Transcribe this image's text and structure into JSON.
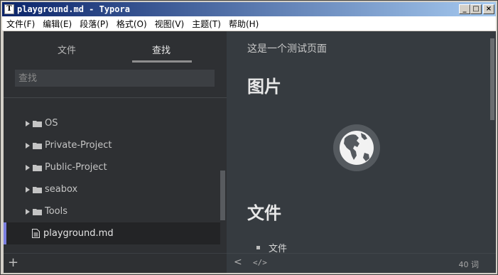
{
  "window": {
    "title": "playground.md - Typora",
    "app_icon": "T",
    "buttons": {
      "minimize": "_",
      "maximize": "□",
      "close": "×"
    }
  },
  "menubar": {
    "items": [
      "文件(F)",
      "编辑(E)",
      "段落(P)",
      "格式(O)",
      "视图(V)",
      "主题(T)",
      "帮助(H)"
    ]
  },
  "sidebar": {
    "tabs": {
      "files": "文件",
      "search": "查找",
      "active": "search"
    },
    "search_placeholder": "查找",
    "tree": [
      {
        "label": "OS",
        "type": "folder"
      },
      {
        "label": "Private-Project",
        "type": "folder"
      },
      {
        "label": "Public-Project",
        "type": "folder"
      },
      {
        "label": "seabox",
        "type": "folder"
      },
      {
        "label": "Tools",
        "type": "folder"
      },
      {
        "label": "playground.md",
        "type": "file",
        "active": true
      }
    ],
    "add_label": "+"
  },
  "editor": {
    "intro": "这是一个测试页面",
    "heading_image": "图片",
    "heading_files": "文件",
    "list_item": "文件",
    "footer": {
      "back": "<",
      "source": "</>",
      "word_count": "40 词"
    }
  },
  "colors": {
    "sidebar_bg": "#2e3033",
    "editor_bg": "#363b40",
    "active_accent": "#7a7ee0",
    "titlebar_start": "#0a246a"
  }
}
